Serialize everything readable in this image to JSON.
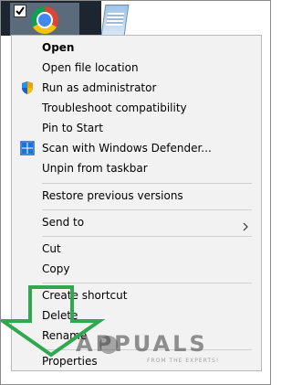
{
  "menu": {
    "items": [
      {
        "label": "Open",
        "bold": true
      },
      {
        "label": "Open file location"
      },
      {
        "label": "Run as administrator",
        "icon": "uac-shield-icon"
      },
      {
        "label": "Troubleshoot compatibility"
      },
      {
        "label": "Pin to Start"
      },
      {
        "label": "Scan with Windows Defender...",
        "icon": "defender-icon"
      },
      {
        "label": "Unpin from taskbar"
      },
      {
        "label": "Restore previous versions"
      },
      {
        "label": "Send to",
        "has_submenu": true
      },
      {
        "label": "Cut"
      },
      {
        "label": "Copy"
      },
      {
        "label": "Create shortcut"
      },
      {
        "label": "Delete"
      },
      {
        "label": "Rename"
      },
      {
        "label": "Properties"
      }
    ]
  },
  "taskbar": {
    "icons": [
      "checkbox-icon",
      "chrome-icon",
      "notepad-icon"
    ]
  },
  "overlay": {
    "arrow_color": "#2fa84f",
    "watermark": "APPUALS",
    "watermark_sub": "FROM THE EXPERTS!"
  }
}
